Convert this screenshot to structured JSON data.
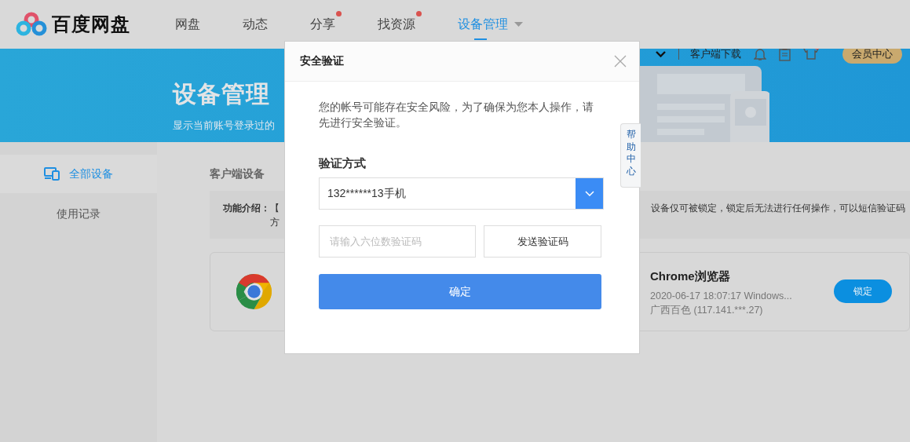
{
  "nav": {
    "logo": "百度网盘",
    "tabs": [
      {
        "label": "网盘",
        "selected": false,
        "badge": false,
        "dropdown": false
      },
      {
        "label": "动态",
        "selected": false,
        "badge": false,
        "dropdown": false
      },
      {
        "label": "分享",
        "selected": false,
        "badge": true,
        "dropdown": false
      },
      {
        "label": "找资源",
        "selected": false,
        "badge": true,
        "dropdown": false
      },
      {
        "label": "设备管理",
        "selected": true,
        "badge": false,
        "dropdown": true
      }
    ]
  },
  "banner": {
    "title": "设备管理",
    "subtitle": "显示当前账号登录过的",
    "toolbar": {
      "download": "客户端下载",
      "shirt_badge": true,
      "vip": "会员中心"
    }
  },
  "sidebar": {
    "items": [
      {
        "label": "全部设备",
        "selected": true,
        "kind": "icon"
      },
      {
        "label": "使用记录",
        "selected": false,
        "kind": "text"
      }
    ]
  },
  "content": {
    "tab": "客户端设备",
    "intro": {
      "label": "功能介绍：",
      "line1": "【",
      "line1_right": "设备仅可被锁定，锁定后无法进行任何操作，可以短信验证码",
      "line2": "方"
    },
    "devices": [
      {
        "name": "Chrome浏览器",
        "time": "2020-06-17 18:07:17 Windows...",
        "location": "广西百色 (117.141.***.27)",
        "button": "锁定"
      }
    ]
  },
  "help_tab": "帮助中心",
  "dialog": {
    "title": "安全验证",
    "message": "您的帐号可能存在安全风险，为了确保为您本人操作，请先进行安全验证。",
    "method_label": "验证方式",
    "method_value": "132******13手机",
    "code_placeholder": "请输入六位数验证码",
    "send_button": "发送验证码",
    "confirm_button": "确定"
  }
}
